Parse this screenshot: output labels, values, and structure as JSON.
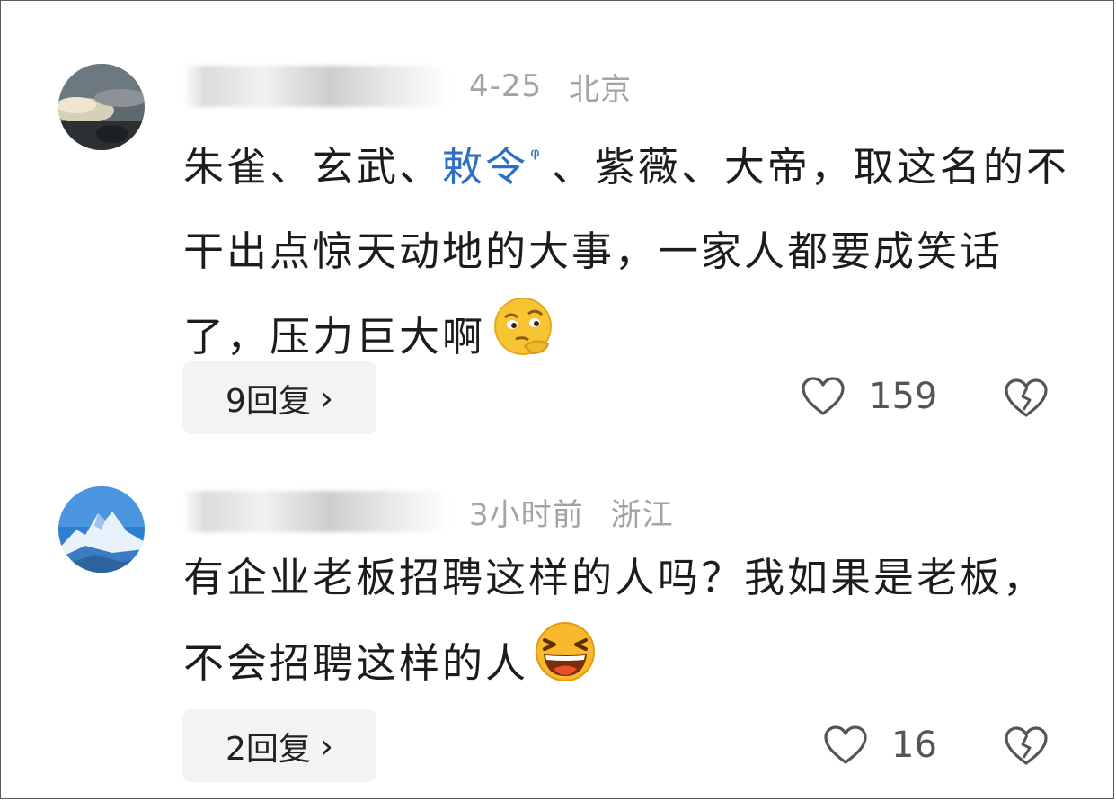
{
  "comments": [
    {
      "date": "4-25",
      "location": "北京",
      "text_before": "朱雀、玄武、",
      "keyword": "敕令",
      "keyword_mark": "ᵠ",
      "text_after": "、紫薇、大帝，取这名的不干出点惊天动地的大事，一家人都要成笑话了，压力巨大啊",
      "emoji_icon": "thinking-face-emoji",
      "reply_label": "9回复",
      "likes": "159"
    },
    {
      "date": "3小时前",
      "location": "浙江",
      "text_before": "有企业老板招聘这样的人吗？我如果是老板，不会招聘这样的人",
      "emoji_icon": "laughing-face-emoji",
      "reply_label": "2回复",
      "likes": "16"
    }
  ],
  "icons": {
    "chevron": "›",
    "like": "heart-outline-icon",
    "dislike": "broken-heart-icon"
  }
}
